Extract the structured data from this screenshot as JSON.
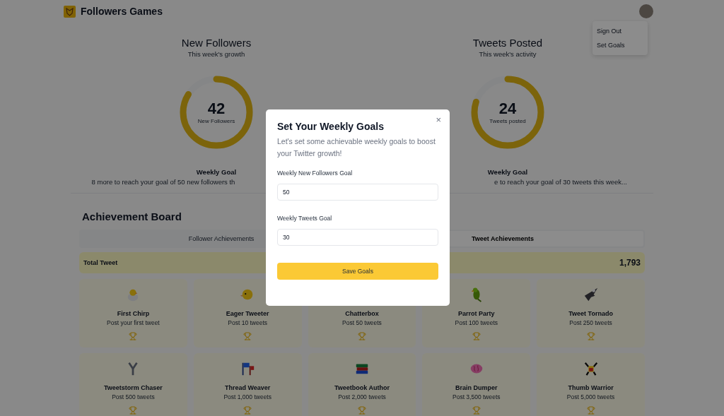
{
  "header": {
    "title": "Followers Games"
  },
  "user_menu": {
    "items": [
      "Sign Out",
      "Set Goals"
    ]
  },
  "stats": [
    {
      "title": "New Followers",
      "subtitle": "This week's growth",
      "value": "42",
      "unit": "New Followers",
      "level": 0.84,
      "goal_title": "Weekly Goal",
      "goal_text": "8 more to reach your goal of 50 new followers th"
    },
    {
      "title": "Tweets Posted",
      "subtitle": "This week's activity",
      "value": "24",
      "unit": "Tweets posted",
      "level": 0.8,
      "goal_title": "Weekly Goal",
      "goal_text": "e to reach your goal of 30 tweets this week..."
    }
  ],
  "achievements": {
    "title": "Achievement Board",
    "tabs": [
      {
        "label": "Follower Achievements",
        "selected": false
      },
      {
        "label": "Tweet Achievements",
        "selected": true
      }
    ],
    "total": {
      "label": "Total Tweet",
      "value": "1,793"
    },
    "items": [
      {
        "name": "First Chirp",
        "requirement": "Post your first tweet"
      },
      {
        "name": "Eager Tweeter",
        "requirement": "Post 10 tweets"
      },
      {
        "name": "Chatterbox",
        "requirement": "Post 50 tweets"
      },
      {
        "name": "Parrot Party",
        "requirement": "Post 100 tweets"
      },
      {
        "name": "Tweet Tornado",
        "requirement": "Post 250 tweets"
      },
      {
        "name": "Tweetstorm Chaser",
        "requirement": "Post 500 tweets"
      },
      {
        "name": "Thread Weaver",
        "requirement": "Post 1,000 tweets"
      },
      {
        "name": "Tweetbook Author",
        "requirement": "Post 2,000 tweets"
      },
      {
        "name": "Brain Dumper",
        "requirement": "Post 3,500 tweets"
      },
      {
        "name": "Thumb Warrior",
        "requirement": "Post 5,000 tweets"
      }
    ]
  },
  "modal": {
    "title": "Set Your Weekly Goals",
    "description": "Let's set some achievable weekly goals to boost your Twitter growth!",
    "close": "×",
    "fields": [
      {
        "label": "Weekly New Followers Goal",
        "value": "50"
      },
      {
        "label": "Weekly Tweets Goal",
        "value": "30"
      }
    ],
    "button": "Save Goals"
  }
}
